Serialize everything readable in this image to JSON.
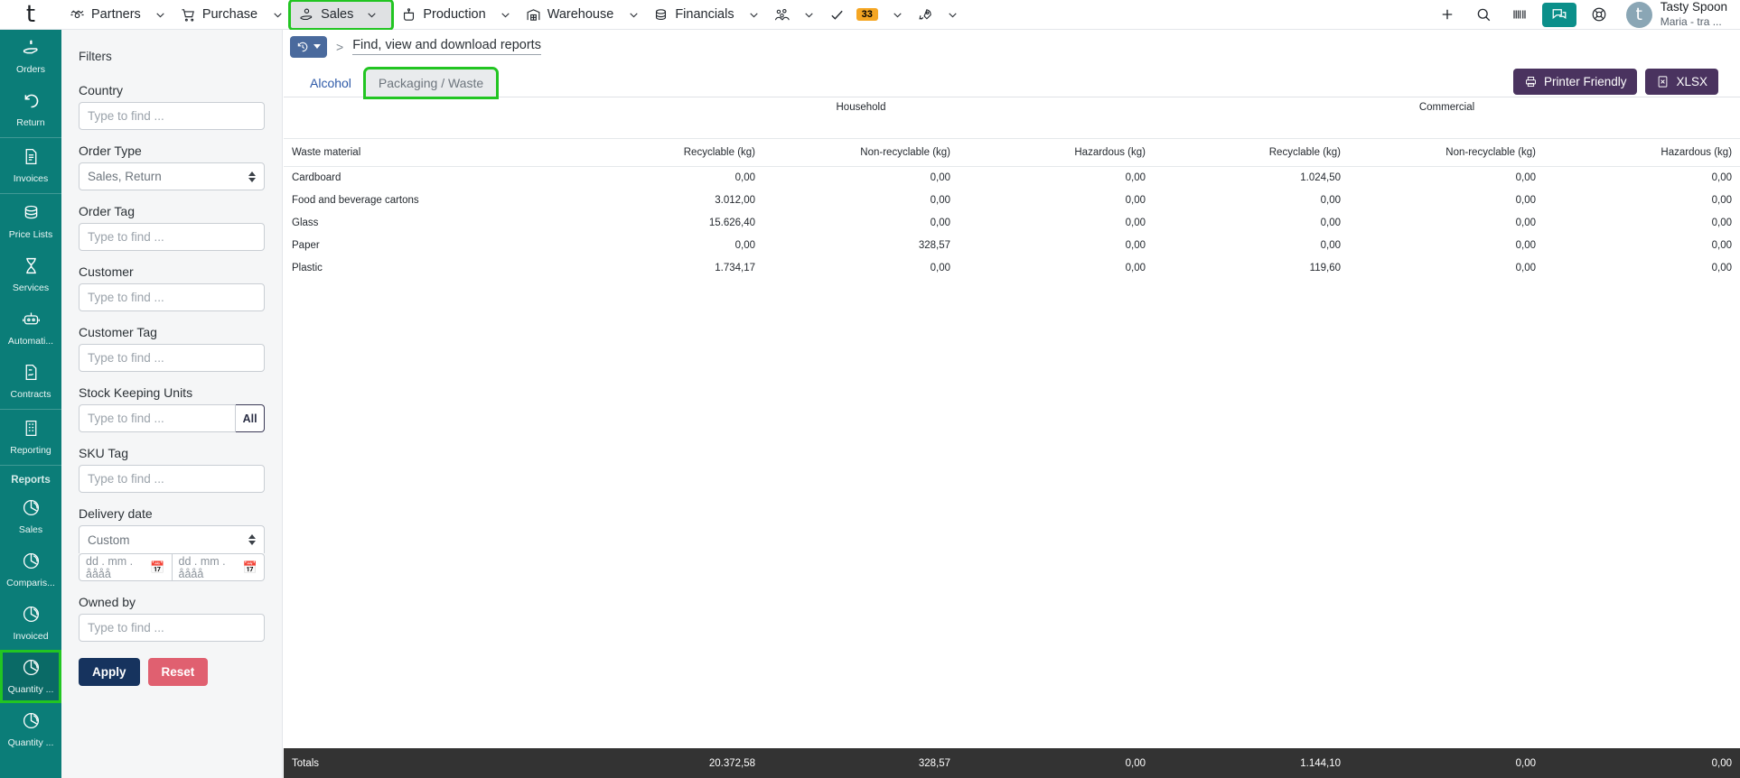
{
  "topbar": {
    "logo": "t",
    "nav": [
      {
        "label": "Partners",
        "icon": "handshake-icon",
        "highlighted": false,
        "caret": true
      },
      {
        "label": "Purchase",
        "icon": "cart-icon",
        "highlighted": false,
        "caret": true
      },
      {
        "label": "Sales",
        "icon": "hand-coin-icon",
        "highlighted": true,
        "caret": true
      },
      {
        "label": "Production",
        "icon": "pot-icon",
        "highlighted": false,
        "caret": true
      },
      {
        "label": "Warehouse",
        "icon": "warehouse-icon",
        "highlighted": false,
        "caret": true
      },
      {
        "label": "Financials",
        "icon": "coins-icon",
        "highlighted": false,
        "caret": true
      },
      {
        "label": "",
        "icon": "people-group-icon",
        "highlighted": false,
        "caret": true
      },
      {
        "label": "",
        "icon": "check-icon",
        "badge": "33",
        "highlighted": false,
        "caret": true
      },
      {
        "label": "",
        "icon": "rocket-icon",
        "highlighted": false,
        "caret": true
      }
    ],
    "right_icons": [
      {
        "name": "plus-icon"
      },
      {
        "name": "search-icon"
      },
      {
        "name": "barcode-icon"
      },
      {
        "name": "chat-icon",
        "accent": true
      },
      {
        "name": "lifebuoy-icon"
      }
    ],
    "user": {
      "avatar_letter": "t",
      "name": "Tasty Spoon",
      "subtitle": "Maria - tra ..."
    },
    "accent_color": "#0b8f8a",
    "badge_color": "#f5a623"
  },
  "sidebar": {
    "items": [
      {
        "label": "Orders",
        "icon": "hand-coin-icon",
        "active": false
      },
      {
        "label": "Return",
        "icon": "undo-icon",
        "active": false,
        "divider_after": true
      },
      {
        "label": "Invoices",
        "icon": "invoice-icon",
        "active": false,
        "divider_after": true
      },
      {
        "label": "Price Lists",
        "icon": "coins-icon",
        "active": false
      },
      {
        "label": "Services",
        "icon": "hourglass-icon",
        "active": false
      },
      {
        "label": "Automati...",
        "icon": "robot-icon",
        "active": false
      },
      {
        "label": "Contracts",
        "icon": "contract-icon",
        "active": false,
        "divider_after": true
      },
      {
        "label": "Reporting",
        "icon": "building-icon",
        "active": false,
        "divider_after": true
      }
    ],
    "section_label": "Reports",
    "report_items": [
      {
        "label": "Sales",
        "icon": "pie-chart-icon",
        "active": false
      },
      {
        "label": "Comparis...",
        "icon": "pie-chart-icon",
        "active": false
      },
      {
        "label": "Invoiced",
        "icon": "pie-chart-icon",
        "active": false
      },
      {
        "label": "Quantity ...",
        "icon": "pie-chart-icon",
        "active": true
      },
      {
        "label": "Quantity ...",
        "icon": "pie-chart-icon",
        "active": false
      }
    ],
    "bg_color": "#0b7d78",
    "active_color": "#0a6a66",
    "highlight_color": "#22c522"
  },
  "filters": {
    "title": "Filters",
    "country": {
      "label": "Country",
      "placeholder": "Type to find ...",
      "value": ""
    },
    "order_type": {
      "label": "Order Type",
      "value": "Sales, Return"
    },
    "order_tag": {
      "label": "Order Tag",
      "placeholder": "Type to find ...",
      "value": ""
    },
    "customer": {
      "label": "Customer",
      "placeholder": "Type to find ...",
      "value": ""
    },
    "customer_tag": {
      "label": "Customer Tag",
      "placeholder": "Type to find ...",
      "value": ""
    },
    "sku": {
      "label": "Stock Keeping Units",
      "placeholder": "Type to find ...",
      "value": "",
      "all_label": "All"
    },
    "sku_tag": {
      "label": "SKU Tag",
      "placeholder": "Type to find ...",
      "value": ""
    },
    "delivery_date": {
      "label": "Delivery date",
      "mode": "Custom",
      "from_placeholder": "dd . mm . åååå",
      "to_placeholder": "dd . mm . åååå"
    },
    "owned_by": {
      "label": "Owned by",
      "placeholder": "Type to find ...",
      "value": ""
    },
    "apply_label": "Apply",
    "reset_label": "Reset",
    "apply_color": "#16335e",
    "reset_color": "#e06070"
  },
  "breadcrumb": {
    "history_tooltip": "History",
    "separator": ">",
    "title": "Find, view and download reports"
  },
  "tabs": [
    {
      "label": "Alcohol",
      "state": "inactive"
    },
    {
      "label": "Packaging / Waste",
      "state": "selected-highlighted"
    }
  ],
  "actions": [
    {
      "label": "Printer Friendly",
      "icon": "printer-icon"
    },
    {
      "label": "XLSX",
      "icon": "spreadsheet-icon"
    }
  ],
  "report": {
    "group_headers": [
      "",
      "Household",
      "",
      "",
      "Commercial",
      "",
      ""
    ],
    "groups": [
      {
        "label": "Household",
        "span": 3
      },
      {
        "label": "Commercial",
        "span": 3
      }
    ],
    "columns": [
      "Waste material",
      "Recyclable (kg)",
      "Non-recyclable (kg)",
      "Hazardous (kg)",
      "Recyclable (kg)",
      "Non-recyclable (kg)",
      "Hazardous (kg)"
    ],
    "rows": [
      {
        "material": "Cardboard",
        "values": [
          "0,00",
          "0,00",
          "0,00",
          "1.024,50",
          "0,00",
          "0,00"
        ]
      },
      {
        "material": "Food and beverage cartons",
        "values": [
          "3.012,00",
          "0,00",
          "0,00",
          "0,00",
          "0,00",
          "0,00"
        ]
      },
      {
        "material": "Glass",
        "values": [
          "15.626,40",
          "0,00",
          "0,00",
          "0,00",
          "0,00",
          "0,00"
        ]
      },
      {
        "material": "Paper",
        "values": [
          "0,00",
          "328,57",
          "0,00",
          "0,00",
          "0,00",
          "0,00"
        ]
      },
      {
        "material": "Plastic",
        "values": [
          "1.734,17",
          "0,00",
          "0,00",
          "119,60",
          "0,00",
          "0,00"
        ]
      }
    ],
    "totals": {
      "label": "Totals",
      "values": [
        "20.372,58",
        "328,57",
        "0,00",
        "1.144,10",
        "0,00",
        "0,00"
      ]
    }
  }
}
